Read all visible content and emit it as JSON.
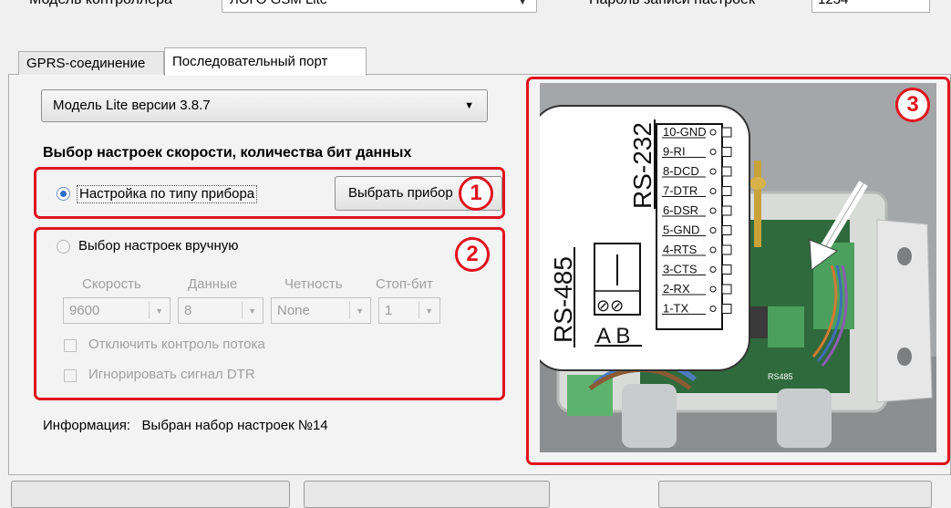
{
  "header": {
    "controller_label": "Модель контроллера",
    "controller_value": "ЛОГО GSM Lite",
    "password_label": "Пароль записи настроек",
    "password_value": "1234"
  },
  "tabs": [
    {
      "label": "GPRS-соединение",
      "active": false
    },
    {
      "label": "Последовательный порт",
      "active": true
    }
  ],
  "model_select": {
    "value": "Модель Lite версии 3.8.7"
  },
  "section_title": "Выбор настроек скорости, количества бит данных",
  "option_by_device": {
    "label": "Настройка по типу прибора",
    "checked": true
  },
  "select_device_button": {
    "label": "Выбрать прибор"
  },
  "option_manual": {
    "label": "Выбор настроек вручную",
    "checked": false
  },
  "manual_fields": [
    {
      "label": "Скорость",
      "value": "9600"
    },
    {
      "label": "Данные",
      "value": "8"
    },
    {
      "label": "Четность",
      "value": "None"
    },
    {
      "label": "Стоп-бит",
      "value": "1"
    }
  ],
  "checkboxes": [
    {
      "label": "Отключить контроль потока",
      "checked": false
    },
    {
      "label": "Игнорировать сигнал DTR",
      "checked": false
    }
  ],
  "info": {
    "label": "Информация:",
    "value": "Выбран набор настроек №14"
  },
  "badges": [
    "1",
    "2",
    "3"
  ],
  "photo": {
    "rs232_title": "RS-232",
    "rs485_title": "RS-485",
    "rs485_ab": "A B",
    "rs485_pins": "⊘⊘",
    "pins": [
      "10-GND",
      "9-RI",
      "8-DCD",
      "7-DTR",
      "6-DSR",
      "5-GND",
      "4-RTS",
      "3-CTS",
      "2-RX",
      "1-TX"
    ],
    "board_mark": "RS485"
  },
  "colors": {
    "highlight": "#e0141e",
    "radio_accent": "#2e6fc4"
  }
}
